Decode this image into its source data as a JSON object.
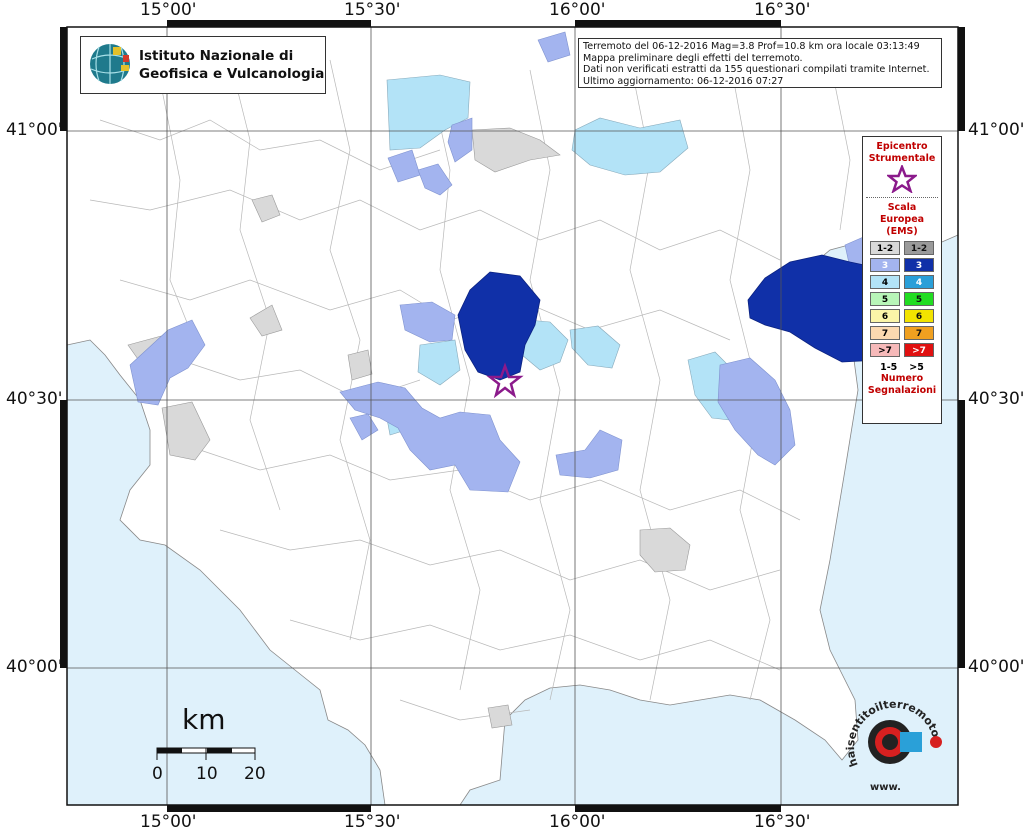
{
  "header": {
    "institute_line1": "Istituto Nazionale di",
    "institute_line2": "Geofisica e Vulcanologia"
  },
  "info": {
    "line1": "Terremoto del 06-12-2016 Mag=3.8 Prof=10.8 km ora locale 03:13:49",
    "line2": "Mappa preliminare degli effetti del terremoto.",
    "line3": "Dati non verificati estratti da 155 questionari compilati tramite Internet.",
    "line4": "Ultimo aggiornamento: 06-12-2016 07:27"
  },
  "axes": {
    "lon_labels": [
      "15°00'",
      "15°30'",
      "16°00'",
      "16°30'"
    ],
    "lat_labels": [
      "41°00'",
      "40°30'",
      "40°00'"
    ]
  },
  "legend": {
    "epicenter_title_1": "Epicentro",
    "epicenter_title_2": "Strumentale",
    "scale_title_1": "Scala",
    "scale_title_2": "Europea",
    "scale_title_3": "(EMS)",
    "rows": [
      {
        "low": "1-2",
        "high": "1-2",
        "low_color": "#d9d9d9",
        "high_color": "#9a9a9a"
      },
      {
        "low": "3",
        "high": "3",
        "low_color": "#a3b4ef",
        "high_color": "#1030a8"
      },
      {
        "low": "4",
        "high": "4",
        "low_color": "#b3e3f7",
        "high_color": "#2a9fd8"
      },
      {
        "low": "5",
        "high": "5",
        "low_color": "#b8f5b8",
        "high_color": "#22dd22"
      },
      {
        "low": "6",
        "high": "6",
        "low_color": "#fbf5a8",
        "high_color": "#f2e300"
      },
      {
        "low": "7",
        "high": "7",
        "low_color": "#fbd9b0",
        "high_color": "#f0a020"
      },
      {
        "low": ">7",
        "high": ">7",
        "low_color": "#f6b9b9",
        "high_color": "#e01010"
      }
    ],
    "count_low": "1-5",
    "count_high": ">5",
    "count_title_1": "Numero",
    "count_title_2": "Segnalazioni"
  },
  "scale_bar": {
    "unit": "km",
    "ticks": [
      "0",
      "10",
      "20"
    ]
  },
  "colors": {
    "sea": "#dff1fb",
    "land": "#ffffff",
    "ems3_low": "#a3b4ef",
    "ems3_high": "#1030a8",
    "ems4_low": "#b3e3f7",
    "ems12": "#d9d9d9",
    "epicenter": "#8b1a8b"
  },
  "watermark": {
    "text": "haisentitoilterremoto.it",
    "url": "www."
  }
}
